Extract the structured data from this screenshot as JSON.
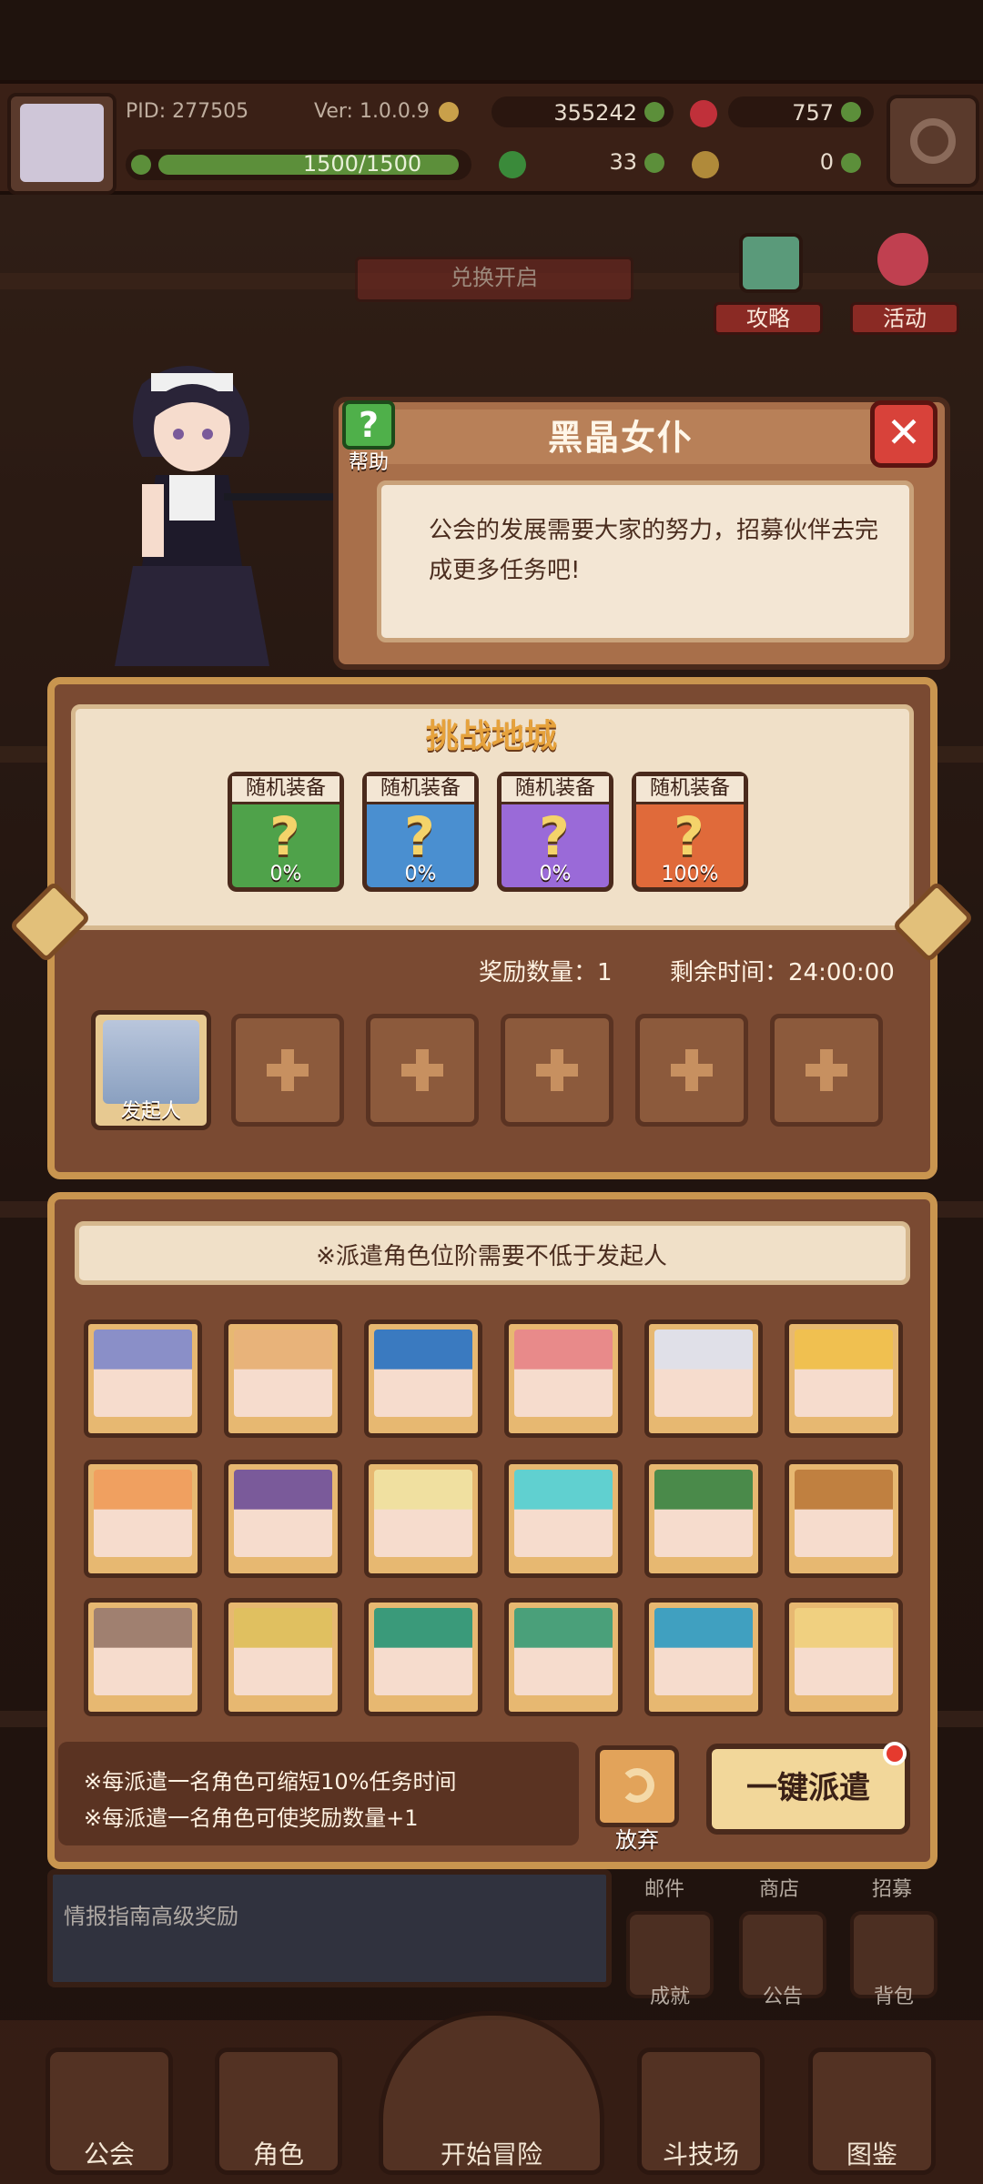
{
  "player": {
    "pid": "PID: 277505",
    "version": "Ver: 1.0.0.9",
    "energy": "1500/1500"
  },
  "currencies": {
    "gold": "355242",
    "gems": "757",
    "clover": "33",
    "keys": "0"
  },
  "side_buttons": {
    "strategy": "攻略",
    "events": "活动",
    "redeem": "兑换开启"
  },
  "dialog": {
    "title": "黑晶女仆",
    "help_label": "帮助",
    "help_symbol": "?",
    "close_symbol": "✕",
    "message": "公会的发展需要大家的努力，招募伙伴去完成更多任务吧!"
  },
  "challenge": {
    "title": "挑战地城",
    "rewards": [
      {
        "label": "随机装备",
        "chance": "0%",
        "color": "#4fa24a"
      },
      {
        "label": "随机装备",
        "chance": "0%",
        "color": "#4a8fd0"
      },
      {
        "label": "随机装备",
        "chance": "0%",
        "color": "#9a6ad8"
      },
      {
        "label": "随机装备",
        "chance": "100%",
        "color": "#e06a3a"
      }
    ],
    "reward_count": "奖励数量：1",
    "time_left": "剩余时间：24:00:00",
    "initiator_label": "发起人"
  },
  "roster": {
    "requirement": "※派遣角色位阶需要不低于发起人",
    "notes": [
      "※每派遣一名角色可缩短10%任务时间",
      "※每派遣一名角色可使奖励数量+1"
    ],
    "give_up": "放弃",
    "dispatch_all": "一键派遣",
    "portraits": [
      "#8a8fc8",
      "#e8b37a",
      "#3a7ac0",
      "#e88a8a",
      "#e0e0e8",
      "#f0c050",
      "#f0a060",
      "#7a5a9a",
      "#f0e0a0",
      "#60d0d0",
      "#4a8a4a",
      "#c08040",
      "#a08070",
      "#e0c060",
      "#3a9a7a",
      "#4aa07a",
      "#40a0c0",
      "#f0d080"
    ]
  },
  "lower_menu": {
    "banner": "情报指南高级奖励",
    "mini": [
      "邮件",
      "商店",
      "招募",
      "成就",
      "公告",
      "背包"
    ]
  },
  "nav": [
    "公会",
    "角色",
    "开始冒险",
    "斗技场",
    "图鉴"
  ]
}
